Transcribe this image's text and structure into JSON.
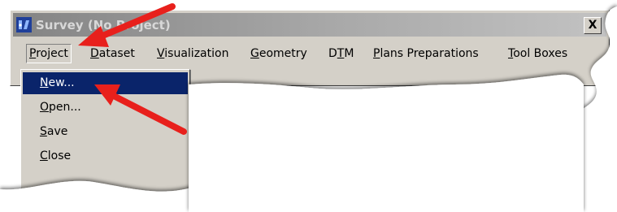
{
  "window": {
    "title": "Survey (No Project)",
    "close_symbol": "X",
    "app_icon": "survey-app-icon"
  },
  "menubar": {
    "items": [
      {
        "mnemonic": "P",
        "rest": "roject"
      },
      {
        "mnemonic": "D",
        "rest": "ataset"
      },
      {
        "mnemonic": "V",
        "rest": "isualization"
      },
      {
        "mnemonic": "G",
        "rest": "eometry"
      },
      {
        "pre": "D",
        "mnemonic": "T",
        "rest": "M"
      },
      {
        "mnemonic": "P",
        "rest": "lans Preparations"
      },
      {
        "mnemonic": "T",
        "rest": "ool Boxes"
      }
    ]
  },
  "project_menu": {
    "items": [
      {
        "mnemonic": "N",
        "rest": "ew..."
      },
      {
        "mnemonic": "O",
        "rest": "pen..."
      },
      {
        "mnemonic": "S",
        "rest": "ave"
      },
      {
        "mnemonic": "C",
        "rest": "lose"
      }
    ],
    "selected_index": 0
  },
  "annotations": {
    "arrow_color": "#e8201c",
    "arrows": [
      "arrow-to-project-menu",
      "arrow-to-new-item"
    ]
  },
  "colors": {
    "window_face": "#d4d0c8",
    "selection": "#0a246a"
  }
}
